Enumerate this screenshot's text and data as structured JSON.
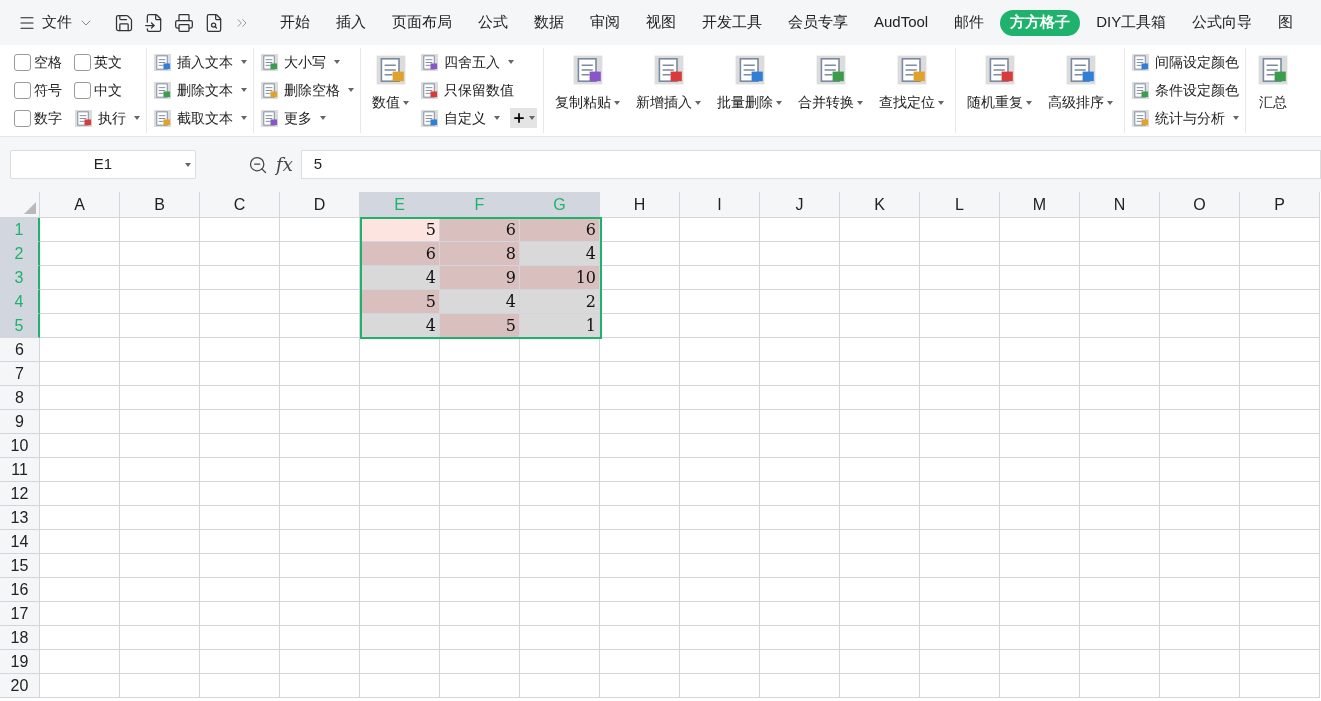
{
  "menu": {
    "file_label": "文件"
  },
  "tabs": [
    {
      "label": "开始",
      "selected": false
    },
    {
      "label": "插入",
      "selected": false
    },
    {
      "label": "页面布局",
      "selected": false
    },
    {
      "label": "公式",
      "selected": false
    },
    {
      "label": "数据",
      "selected": false
    },
    {
      "label": "审阅",
      "selected": false
    },
    {
      "label": "视图",
      "selected": false
    },
    {
      "label": "开发工具",
      "selected": false
    },
    {
      "label": "会员专享",
      "selected": false
    },
    {
      "label": "AudTool",
      "selected": false
    },
    {
      "label": "邮件",
      "selected": false
    },
    {
      "label": "方方格子",
      "selected": true
    },
    {
      "label": "DIY工具箱",
      "selected": false
    },
    {
      "label": "公式向导",
      "selected": false
    },
    {
      "label": "图",
      "selected": false
    }
  ],
  "ribbon_groups": [
    {
      "items": [
        {
          "kind": "checkbox",
          "label": "空格",
          "checked": false
        },
        {
          "kind": "checkbox",
          "label": "符号",
          "checked": false
        },
        {
          "kind": "checkbox",
          "label": "数字",
          "checked": false
        },
        {
          "kind": "checkbox",
          "label": "英文",
          "checked": false
        },
        {
          "kind": "checkbox",
          "label": "中文",
          "checked": false
        },
        {
          "kind": "small",
          "label": "执行",
          "dropdown": true
        }
      ]
    },
    {
      "items": [
        {
          "kind": "small",
          "label": "插入文本",
          "dropdown": true
        },
        {
          "kind": "small",
          "label": "删除文本",
          "dropdown": true
        },
        {
          "kind": "small",
          "label": "截取文本",
          "dropdown": true
        }
      ]
    },
    {
      "items": [
        {
          "kind": "small",
          "label": "大小写",
          "dropdown": true
        },
        {
          "kind": "small",
          "label": "删除空格",
          "dropdown": true
        },
        {
          "kind": "small",
          "label": "更多",
          "dropdown": true
        }
      ]
    },
    {
      "items": [
        {
          "kind": "large",
          "label": "数值",
          "dropdown": true
        },
        {
          "kind": "small",
          "label": "四舍五入",
          "dropdown": true
        },
        {
          "kind": "small",
          "label": "只保留数值",
          "dropdown": false
        },
        {
          "kind": "small",
          "label": "自定义",
          "dropdown": true,
          "addon": true
        }
      ]
    },
    {
      "items": [
        {
          "kind": "large",
          "label": "复制粘贴",
          "dropdown": true
        },
        {
          "kind": "large",
          "label": "新增插入",
          "dropdown": true
        },
        {
          "kind": "large",
          "label": "批量删除",
          "dropdown": true
        },
        {
          "kind": "large",
          "label": "合并转换",
          "dropdown": true
        },
        {
          "kind": "large",
          "label": "查找定位",
          "dropdown": true
        }
      ]
    },
    {
      "items": [
        {
          "kind": "large",
          "label": "随机重复",
          "dropdown": true
        },
        {
          "kind": "large",
          "label": "高级排序",
          "dropdown": true
        }
      ]
    },
    {
      "items": [
        {
          "kind": "small",
          "label": "间隔设定颜色",
          "dropdown": false
        },
        {
          "kind": "small",
          "label": "条件设定颜色",
          "dropdown": false
        },
        {
          "kind": "small",
          "label": "统计与分析",
          "dropdown": true
        }
      ]
    },
    {
      "items": [
        {
          "kind": "large",
          "label": "汇总",
          "dropdown": false
        }
      ]
    }
  ],
  "formula_bar": {
    "name_box": "E1",
    "fx_label": "fx",
    "value": "5"
  },
  "sheet": {
    "columns": [
      {
        "label": "A",
        "selected": false
      },
      {
        "label": "B",
        "selected": false
      },
      {
        "label": "C",
        "selected": false
      },
      {
        "label": "D",
        "selected": false
      },
      {
        "label": "E",
        "selected": true
      },
      {
        "label": "F",
        "selected": true
      },
      {
        "label": "G",
        "selected": true
      },
      {
        "label": "H",
        "selected": false
      },
      {
        "label": "I",
        "selected": false
      },
      {
        "label": "J",
        "selected": false
      },
      {
        "label": "K",
        "selected": false
      },
      {
        "label": "L",
        "selected": false
      },
      {
        "label": "M",
        "selected": false
      },
      {
        "label": "N",
        "selected": false
      },
      {
        "label": "O",
        "selected": false
      },
      {
        "label": "P",
        "selected": false
      }
    ],
    "rows": [
      {
        "label": "1",
        "selected": true,
        "cells": [
          {
            "value": "5",
            "color": "#fde4e1"
          },
          {
            "value": "6",
            "color": "#d9c0bf"
          },
          {
            "value": "6",
            "color": "#d9c0bf"
          }
        ]
      },
      {
        "label": "2",
        "selected": true,
        "cells": [
          {
            "value": "6",
            "color": "#d9c0bf"
          },
          {
            "value": "8",
            "color": "#d9c0bf"
          },
          {
            "value": "4",
            "color": "#d9d9d9"
          }
        ]
      },
      {
        "label": "3",
        "selected": true,
        "cells": [
          {
            "value": "4",
            "color": "#d9d9d9"
          },
          {
            "value": "9",
            "color": "#d9c0bf"
          },
          {
            "value": "10",
            "color": "#d9c0bf"
          }
        ]
      },
      {
        "label": "4",
        "selected": true,
        "cells": [
          {
            "value": "5",
            "color": "#d9c0bf"
          },
          {
            "value": "4",
            "color": "#d9d9d9"
          },
          {
            "value": "2",
            "color": "#d9d9d9"
          }
        ]
      },
      {
        "label": "5",
        "selected": true,
        "cells": [
          {
            "value": "4",
            "color": "#d9d9d9"
          },
          {
            "value": "5",
            "color": "#d9c0bf"
          },
          {
            "value": "1",
            "color": "#d9d9d9"
          }
        ]
      },
      {
        "label": "6",
        "selected": false
      },
      {
        "label": "7",
        "selected": false
      },
      {
        "label": "8",
        "selected": false
      },
      {
        "label": "9",
        "selected": false
      },
      {
        "label": "10",
        "selected": false
      },
      {
        "label": "11",
        "selected": false
      },
      {
        "label": "12",
        "selected": false
      },
      {
        "label": "13",
        "selected": false
      },
      {
        "label": "14",
        "selected": false
      },
      {
        "label": "15",
        "selected": false
      },
      {
        "label": "16",
        "selected": false
      },
      {
        "label": "17",
        "selected": false
      },
      {
        "label": "18",
        "selected": false
      },
      {
        "label": "19",
        "selected": false
      },
      {
        "label": "20",
        "selected": false
      }
    ]
  }
}
